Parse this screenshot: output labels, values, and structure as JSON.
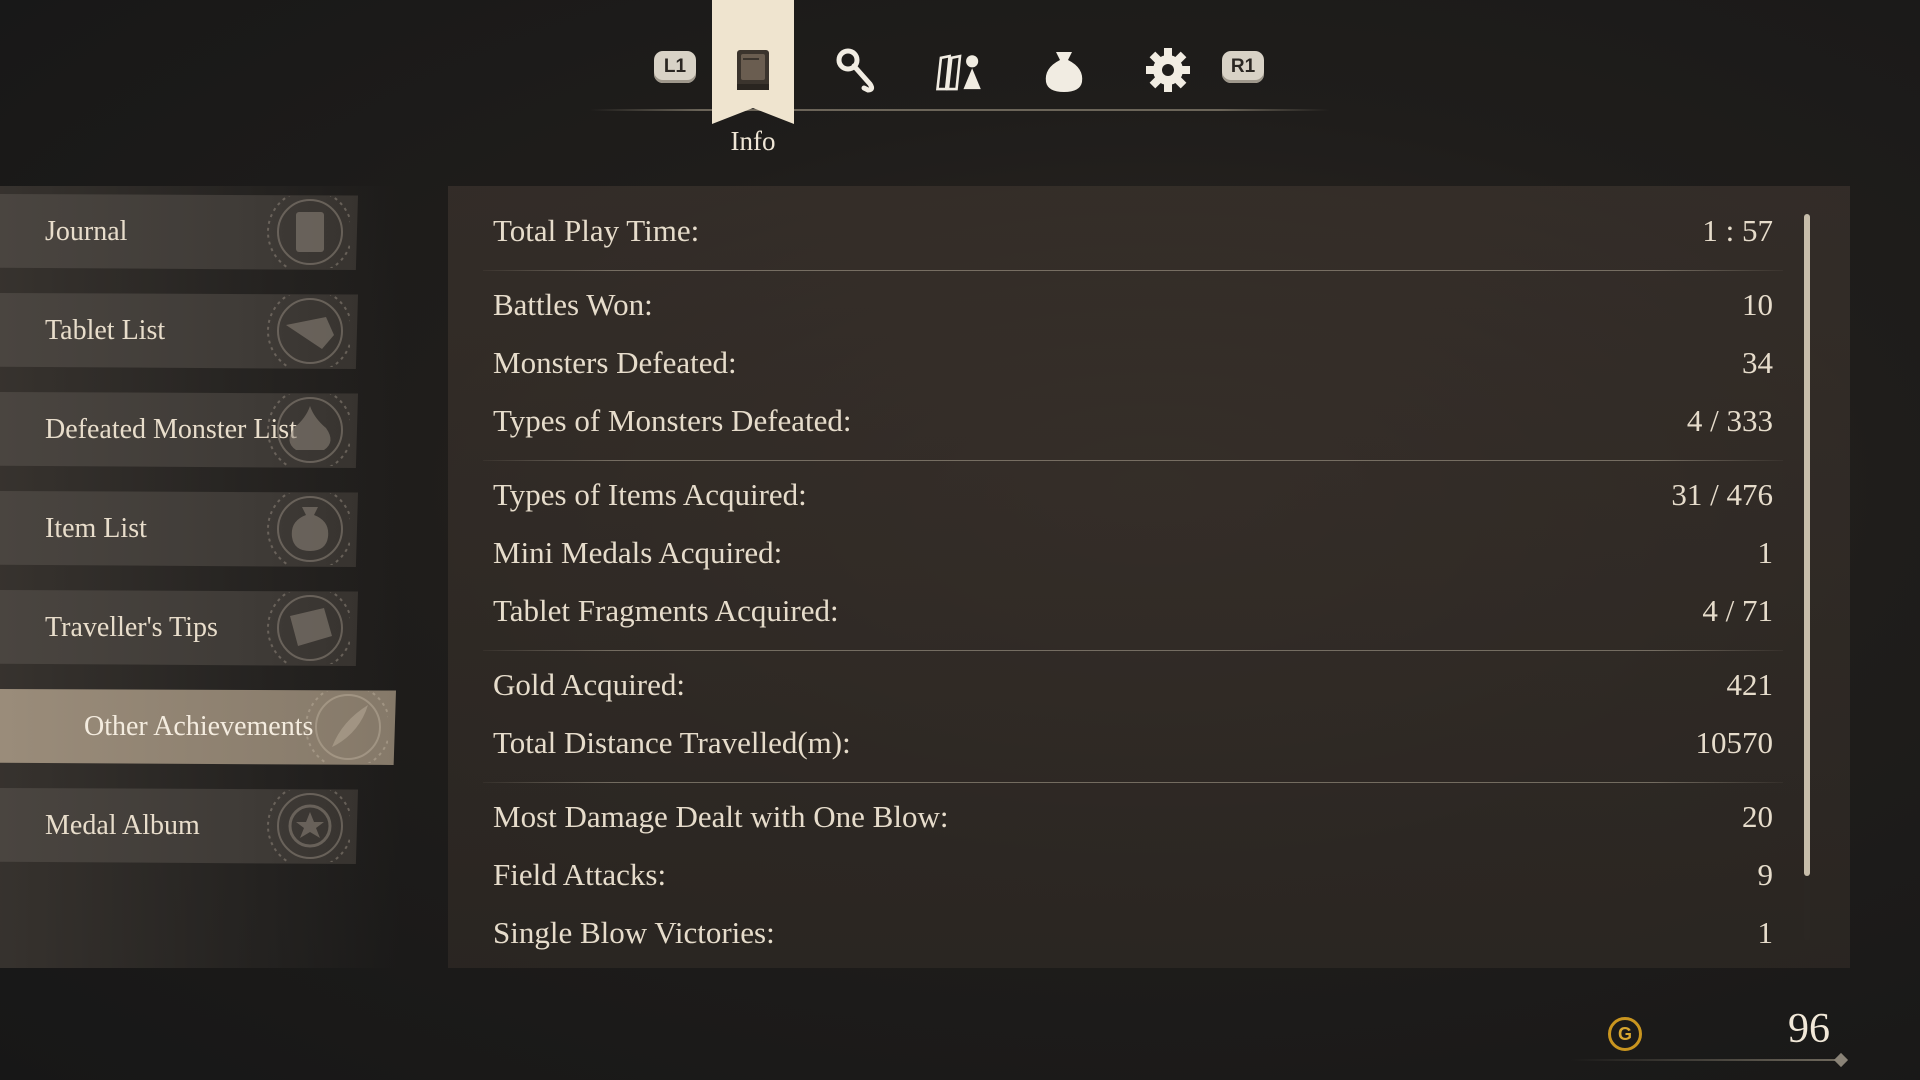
{
  "tabs": {
    "left_shoulder": "L1",
    "right_shoulder": "R1",
    "active_caption": "Info",
    "items": [
      {
        "icon": "book-icon",
        "active": true
      },
      {
        "icon": "magic-staff-icon",
        "active": false
      },
      {
        "icon": "party-icon",
        "active": false
      },
      {
        "icon": "bag-icon",
        "active": false
      },
      {
        "icon": "gear-icon",
        "active": false
      }
    ]
  },
  "sidebar": {
    "items": [
      {
        "label": "Journal",
        "icon": "book-icon"
      },
      {
        "label": "Tablet List",
        "icon": "tablet-icon"
      },
      {
        "label": "Defeated Monster List",
        "icon": "slime-icon"
      },
      {
        "label": "Item List",
        "icon": "bag-icon"
      },
      {
        "label": "Traveller's Tips",
        "icon": "scroll-icon"
      },
      {
        "label": "Other Achievements",
        "icon": "quill-icon",
        "active": true
      },
      {
        "label": "Medal Album",
        "icon": "medal-icon"
      }
    ]
  },
  "stats": [
    {
      "label": "Total Play Time:",
      "value": "1 : 57"
    },
    {
      "label": "Battles Won:",
      "value": "10"
    },
    {
      "label": "Monsters Defeated:",
      "value": "34"
    },
    {
      "label": "Types of Monsters Defeated:",
      "value": "4 / 333"
    },
    {
      "label": "Types of Items Acquired:",
      "value": "31 / 476"
    },
    {
      "label": "Mini Medals Acquired:",
      "value": "1"
    },
    {
      "label": "Tablet Fragments Acquired:",
      "value": "4 / 71"
    },
    {
      "label": "Gold Acquired:",
      "value": "421"
    },
    {
      "label": "Total Distance Travelled(m):",
      "value": "10570"
    },
    {
      "label": "Most Damage Dealt with One Blow:",
      "value": "20"
    },
    {
      "label": "Field Attacks:",
      "value": "9"
    },
    {
      "label": "Single Blow Victories:",
      "value": "1"
    }
  ],
  "gold": {
    "coin_symbol": "G",
    "amount": "96"
  },
  "colors": {
    "accent": "#efe4cf",
    "active_item": "#958876",
    "coin": "#c9951f"
  }
}
